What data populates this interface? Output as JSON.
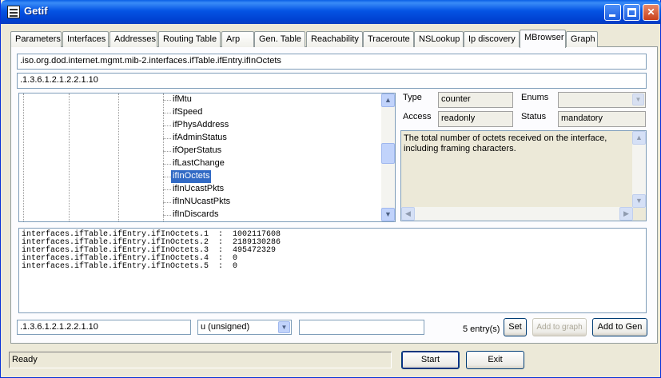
{
  "window": {
    "title": "Getif"
  },
  "tabs": [
    {
      "label": "Parameters"
    },
    {
      "label": "Interfaces"
    },
    {
      "label": "Addresses"
    },
    {
      "label": "Routing Table"
    },
    {
      "label": "Arp"
    },
    {
      "label": "Gen. Table"
    },
    {
      "label": "Reachability"
    },
    {
      "label": "Traceroute"
    },
    {
      "label": "NSLookup"
    },
    {
      "label": "Ip discovery"
    },
    {
      "label": "MBrowser",
      "active": true
    },
    {
      "label": "Graph"
    }
  ],
  "mbrowser": {
    "oid_name": ".iso.org.dod.internet.mgmt.mib-2.interfaces.ifTable.ifEntry.ifInOctets",
    "oid_numeric": ".1.3.6.1.2.1.2.2.1.10",
    "tree_items": [
      "ifMtu",
      "ifSpeed",
      "ifPhysAddress",
      "ifAdminStatus",
      "ifOperStatus",
      "ifLastChange",
      "ifInOctets",
      "ifInUcastPkts",
      "ifInNUcastPkts",
      "ifInDiscards"
    ],
    "selected_item": "ifInOctets",
    "info": {
      "type_label": "Type",
      "type_value": "counter",
      "enums_label": "Enums",
      "enums_value": "",
      "access_label": "Access",
      "access_value": "readonly",
      "status_label": "Status",
      "status_value": "mandatory"
    },
    "description": "The total number of octets received on the interface, including framing characters.",
    "output_lines": [
      "interfaces.ifTable.ifEntry.ifInOctets.1  :  1002117608",
      "interfaces.ifTable.ifEntry.ifInOctets.2  :  2189130286",
      "interfaces.ifTable.ifEntry.ifInOctets.3  :  495472329",
      "interfaces.ifTable.ifEntry.ifInOctets.4  :  0",
      "interfaces.ifTable.ifEntry.ifInOctets.5  :  0"
    ],
    "set_oid": ".1.3.6.1.2.1.2.2.1.10",
    "set_type": "u (unsigned)",
    "set_value": "",
    "entry_count": "5 entry(s)",
    "set_label": "Set",
    "add_graph_label": "Add to graph",
    "add_gen_label": "Add to Gen"
  },
  "status_bar": {
    "text": "Ready"
  },
  "actions": {
    "start_label": "Start",
    "exit_label": "Exit"
  }
}
